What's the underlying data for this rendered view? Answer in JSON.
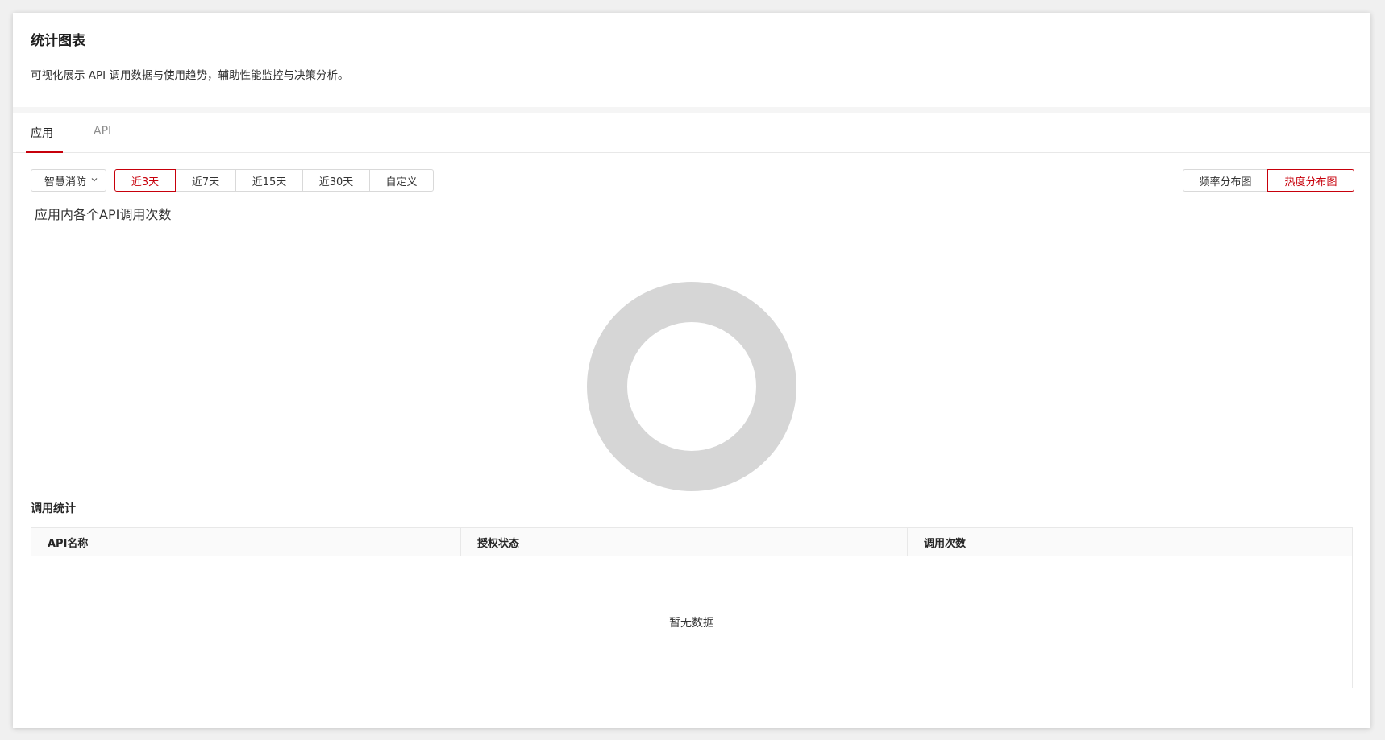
{
  "header": {
    "title": "统计图表",
    "description": "可视化展示 API 调用数据与使用趋势，辅助性能监控与决策分析。"
  },
  "tabs": [
    {
      "label": "应用",
      "active": true
    },
    {
      "label": "API",
      "active": false
    }
  ],
  "filters": {
    "app_select": {
      "value": "智慧消防"
    },
    "time_ranges": [
      {
        "label": "近3天",
        "active": true
      },
      {
        "label": "近7天",
        "active": false
      },
      {
        "label": "近15天",
        "active": false
      },
      {
        "label": "近30天",
        "active": false
      },
      {
        "label": "自定义",
        "active": false
      }
    ],
    "views": [
      {
        "label": "频率分布图",
        "active": false
      },
      {
        "label": "热度分布图",
        "active": true
      }
    ]
  },
  "chart": {
    "title": "应用内各个API调用次数",
    "empty_ring_color": "#d6d6d6"
  },
  "chart_data": {
    "type": "pie",
    "title": "应用内各个API调用次数",
    "categories": [],
    "values": []
  },
  "stats": {
    "title": "调用统计",
    "columns": [
      "API名称",
      "授权状态",
      "调用次数"
    ],
    "rows": [],
    "empty_text": "暂无数据"
  },
  "colors": {
    "accent": "#c7000b",
    "border": "#d9d9d9"
  }
}
